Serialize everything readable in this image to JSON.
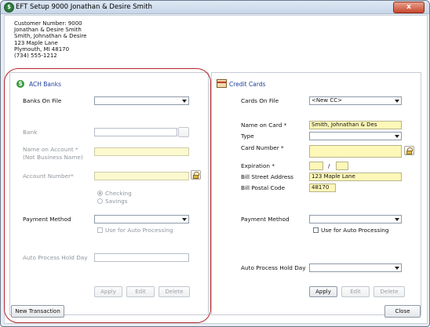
{
  "window": {
    "title": "EFT Setup 9000 Jonathan & Desire Smith",
    "close_glyph": "x"
  },
  "customer": {
    "number_line": "Customer Number: 9000",
    "name_line": "Jonathan & Desire Smith",
    "alt_name_line": "Smith, Johnathan & Desire",
    "address_line": "123 Maple Lane",
    "city_line": "Plymouth, MI  48170",
    "phone_line": "(734) 555-1212"
  },
  "ach": {
    "title": "ACH Banks",
    "banks_on_file": {
      "label": "Banks On File",
      "value": ""
    },
    "bank": {
      "label": "Bank",
      "value": ""
    },
    "name_on_account": {
      "label": "Name on Account *",
      "sublabel": "(Not Business Name)",
      "value": ""
    },
    "account_number": {
      "label": "Account Number*",
      "value": ""
    },
    "checking_label": "Checking",
    "savings_label": "Savings",
    "payment_method": {
      "label": "Payment Method",
      "value": ""
    },
    "auto_processing_label": "Use for Auto Processing",
    "auto_process_hold_day": {
      "label": "Auto Process Hold Day",
      "value": ""
    },
    "buttons": {
      "apply": "Apply",
      "edit": "Edit",
      "delete": "Delete"
    }
  },
  "credit": {
    "title": "Credit Cards",
    "cards_on_file": {
      "label": "Cards On File",
      "value": "<New CC>"
    },
    "name_on_card": {
      "label": "Name on Card *",
      "value": "Smith, Johnathan & Des"
    },
    "type": {
      "label": "Type",
      "value": ""
    },
    "card_number": {
      "label": "Card Number *",
      "value": ""
    },
    "expiration": {
      "label": "Expiration *",
      "separator": "/"
    },
    "bill_street": {
      "label": "Bill Street Address",
      "value": "123 Maple Lane"
    },
    "bill_postal": {
      "label": "Bill Postal Code",
      "value": "48170"
    },
    "payment_method": {
      "label": "Payment Method",
      "value": ""
    },
    "auto_processing_label": "Use for Auto Processing",
    "auto_process_hold_day": {
      "label": "Auto Process Hold Day",
      "value": ""
    },
    "buttons": {
      "apply": "Apply",
      "edit": "Edit",
      "delete": "Delete"
    }
  },
  "footer": {
    "new_transaction": "New Transaction",
    "close": "Close"
  },
  "colors": {
    "highlight": "#b5262b",
    "required_field": "#fdf7b8",
    "panel_title": "#1f3f9a"
  }
}
